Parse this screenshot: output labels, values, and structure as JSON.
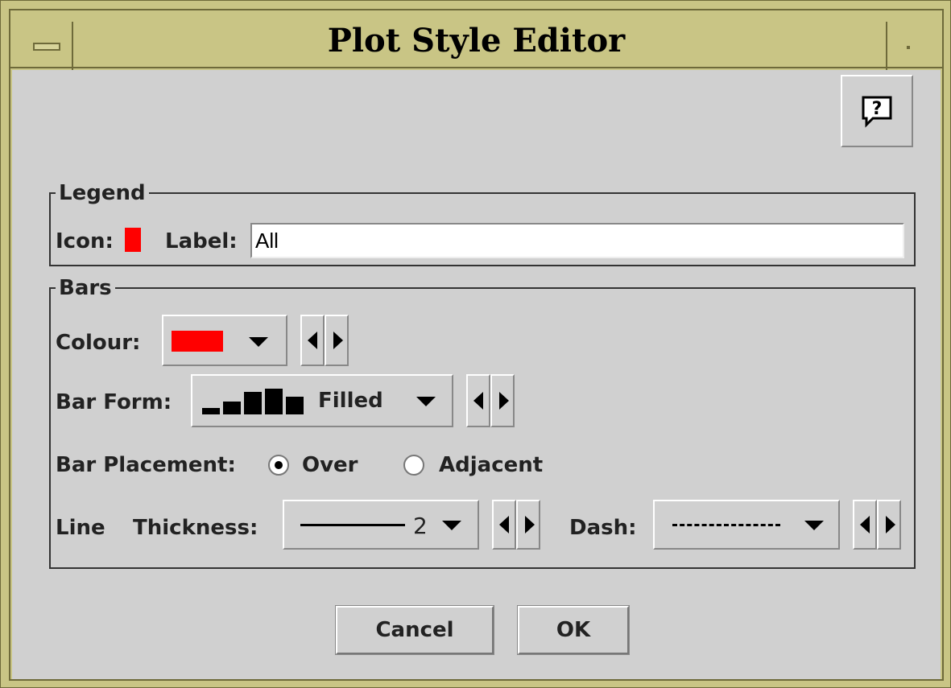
{
  "window": {
    "title": "Plot Style Editor"
  },
  "legend_group": {
    "title": "Legend",
    "icon_label": "Icon:",
    "label_label": "Label:",
    "label_value": "All",
    "icon_color": "#ff0000"
  },
  "bars_group": {
    "title": "Bars",
    "colour_label": "Colour:",
    "colour_value": "#ff0000",
    "bar_form_label": "Bar Form:",
    "bar_form_value": "Filled",
    "bar_placement_label": "Bar Placement:",
    "placement_options": [
      {
        "label": "Over",
        "selected": true
      },
      {
        "label": "Adjacent",
        "selected": false
      }
    ],
    "line_label": "Line",
    "thickness_label": "Thickness:",
    "thickness_value": "2",
    "dash_label": "Dash:"
  },
  "buttons": {
    "cancel": "Cancel",
    "ok": "OK"
  },
  "icons": [
    "window-menu-icon",
    "maximize-icon",
    "help-icon",
    "bar-form-icon",
    "line-sample-icon",
    "dash-sample-icon"
  ]
}
